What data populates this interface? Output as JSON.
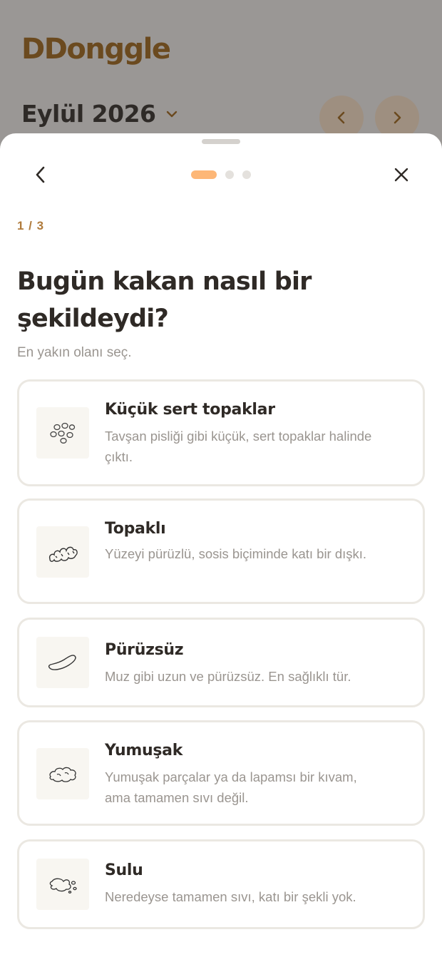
{
  "app": {
    "logo_text": "DDonggle",
    "month_label": "Eylül 2026",
    "brand_color": "#6b4a1f"
  },
  "sheet": {
    "step_counter": "1 / 3",
    "step_current": 1,
    "step_total": 3,
    "question": "Bugün kakan nasıl bir şekildeydi?",
    "hint": "En yakın olanı seç.",
    "accent_color": "#fdb777",
    "icons": {
      "back": "chevron-left-icon",
      "close": "close-icon"
    },
    "options": [
      {
        "title": "Küçük sert topaklar",
        "desc": "Tavşan pisliği gibi küçük, sert topaklar halinde çıktı.",
        "icon": "pellets-icon"
      },
      {
        "title": "Topaklı",
        "desc": "Yüzeyi pürüzlü, sosis biçiminde katı bir dışkı.",
        "icon": "lumpy-icon"
      },
      {
        "title": "Pürüzsüz",
        "desc": "Muz gibi uzun ve pürüzsüz. En sağlıklı tür.",
        "icon": "smooth-icon"
      },
      {
        "title": "Yumuşak",
        "desc": "Yumuşak parçalar ya da lapamsı bir kıvam, ama tamamen sıvı değil.",
        "icon": "soft-icon"
      },
      {
        "title": "Sulu",
        "desc": "Neredeyse tamamen sıvı, katı bir şekli yok.",
        "icon": "watery-icon"
      }
    ]
  }
}
